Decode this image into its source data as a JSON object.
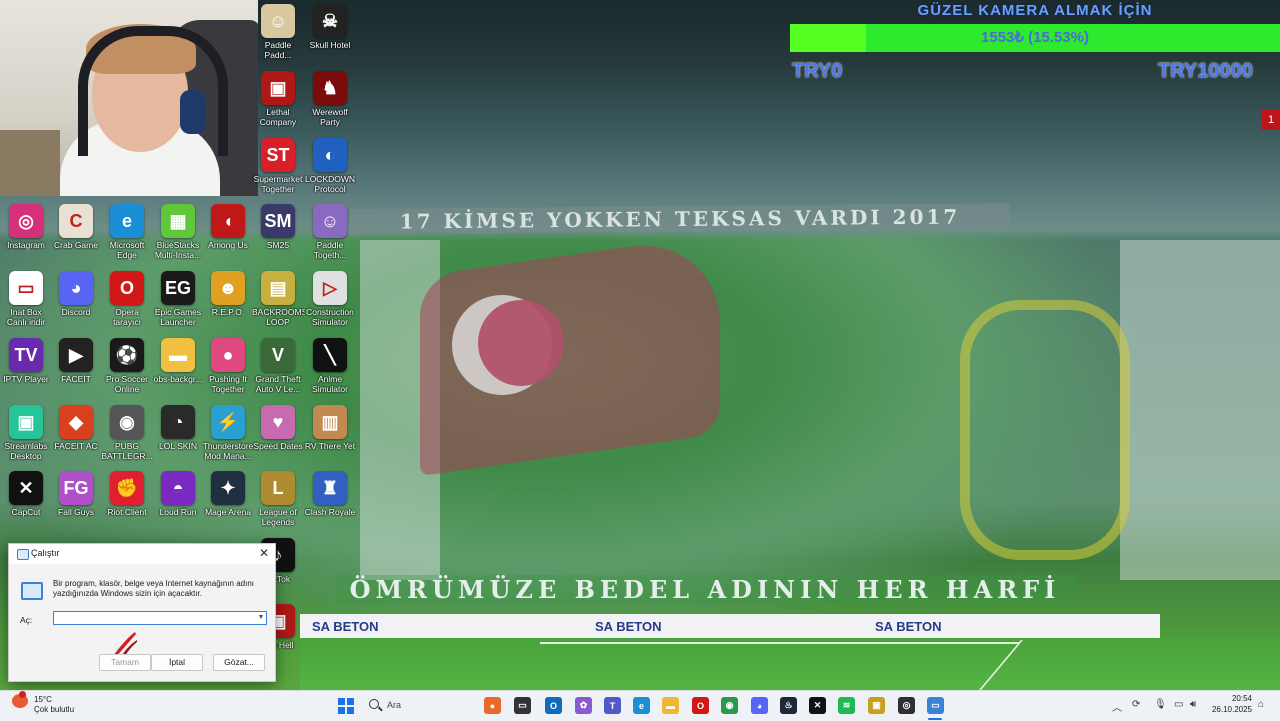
{
  "wallpaper": {
    "banner_top": "17 KİMSE YOKKEN TEKSAS VARDI 2017",
    "banner_bottom": "ÖMRÜMÜZE BEDEL ADININ HER HARFİ",
    "ads": [
      "SA BETON",
      "SA BETON",
      "SA BETON"
    ]
  },
  "goal": {
    "title": "GÜZEL KAMERA ALMAK İÇİN",
    "progress_text": "1553₺ (15.53%)",
    "progress_fraction": 0.1553,
    "min_label": "TRY0",
    "max_label": "TRY10000",
    "bar_color": "#2eea2e",
    "fill_color": "#55ff22"
  },
  "desktop_icons": [
    {
      "label": "Paddle Padd...",
      "icon": "paddle-icon",
      "color": "#d8c8a0",
      "glyph": "☺"
    },
    {
      "label": "Skull Hotel",
      "icon": "skull-hotel-icon",
      "color": "#222222",
      "glyph": "☠"
    },
    {
      "label": "Lethal Company",
      "icon": "lethal-company-icon",
      "color": "#b01818",
      "glyph": "▣"
    },
    {
      "label": "Werewolf Party",
      "icon": "werewolf-party-icon",
      "color": "#7a0c0c",
      "glyph": "♞"
    },
    {
      "label": "Supermarket Together",
      "icon": "supermarket-together-icon",
      "color": "#d8202a",
      "glyph": "ST"
    },
    {
      "label": "LOCKDOWN Protocol",
      "icon": "lockdown-protocol-icon",
      "color": "#2060c0",
      "glyph": "◐"
    },
    {
      "label": "Instagram",
      "icon": "instagram-icon",
      "color": "#d6307a",
      "glyph": "◎"
    },
    {
      "label": "Crab Game",
      "icon": "crab-game-icon",
      "color": "#e8e0d0",
      "glyph": "C"
    },
    {
      "label": "Microsoft Edge",
      "icon": "edge-icon",
      "color": "#1b8fd6",
      "glyph": "e"
    },
    {
      "label": "BlueStacks Multi-Insta...",
      "icon": "bluestacks-icon",
      "color": "#5fc83a",
      "glyph": "▦"
    },
    {
      "label": "Among Us",
      "icon": "among-us-icon",
      "color": "#c01818",
      "glyph": "◖"
    },
    {
      "label": "SM25",
      "icon": "sm25-icon",
      "color": "#3a3a6a",
      "glyph": "SM"
    },
    {
      "label": "Paddle Togeth...",
      "icon": "paddle-together-icon",
      "color": "#8a6ac0",
      "glyph": "☺"
    },
    {
      "label": "Inat Box Canlı indir Turbo",
      "icon": "inatbox-icon",
      "color": "#ffffff",
      "glyph": "▭"
    },
    {
      "label": "Discord",
      "icon": "discord-icon",
      "color": "#5865f2",
      "glyph": "◕"
    },
    {
      "label": "Opera tarayıcı",
      "icon": "opera-icon",
      "color": "#d01818",
      "glyph": "O"
    },
    {
      "label": "Epic Games Launcher",
      "icon": "epic-games-icon",
      "color": "#1a1a1a",
      "glyph": "EG"
    },
    {
      "label": "R.E.P.O.",
      "icon": "repo-icon",
      "color": "#e0a020",
      "glyph": "☻"
    },
    {
      "label": "BACKROOMS LOOP",
      "icon": "backrooms-icon",
      "color": "#c8b040",
      "glyph": "▤"
    },
    {
      "label": "Construction Simulator",
      "icon": "construction-simulator-icon",
      "color": "#e0e0e0",
      "glyph": "▷"
    },
    {
      "label": "IPTV Player",
      "icon": "iptv-icon",
      "color": "#6a2ab0",
      "glyph": "TV"
    },
    {
      "label": "FACEIT",
      "icon": "faceit-icon",
      "color": "#222222",
      "glyph": "▶"
    },
    {
      "label": "Pro Soccer Online",
      "icon": "pro-soccer-icon",
      "color": "#1a1a1a",
      "glyph": "⚽"
    },
    {
      "label": "obs-backgr...",
      "icon": "folder-icon",
      "color": "#f0c040",
      "glyph": "▬"
    },
    {
      "label": "Pushing It Together",
      "icon": "pushing-it-icon",
      "color": "#e04880",
      "glyph": "●"
    },
    {
      "label": "Grand Theft Auto V Le...",
      "icon": "gta-icon",
      "color": "#3a6a3a",
      "glyph": "V"
    },
    {
      "label": "Anime Simulator",
      "icon": "anime-simulator-icon",
      "color": "#111111",
      "glyph": "╲"
    },
    {
      "label": "Streamlabs Desktop",
      "icon": "streamlabs-icon",
      "color": "#27c49a",
      "glyph": "▣"
    },
    {
      "label": "FACEIT AC",
      "icon": "faceit-ac-icon",
      "color": "#d84020",
      "glyph": "◆"
    },
    {
      "label": "PUBG BATTLEGR...",
      "icon": "pubg-icon",
      "color": "#555555",
      "glyph": "◉"
    },
    {
      "label": "LOL SKIN",
      "icon": "lol-skin-icon",
      "color": "#2a2a2a",
      "glyph": "◔"
    },
    {
      "label": "Thunderstore Mod Mana...",
      "icon": "thunderstore-icon",
      "color": "#2aa0d0",
      "glyph": "⚡"
    },
    {
      "label": "Speed Dates",
      "icon": "speed-dates-icon",
      "color": "#c86ab0",
      "glyph": "♥"
    },
    {
      "label": "RV There Yet",
      "icon": "rv-there-yet-icon",
      "color": "#c08a50",
      "glyph": "▥"
    },
    {
      "label": "CapCut",
      "icon": "capcut-icon",
      "color": "#111111",
      "glyph": "✕"
    },
    {
      "label": "Fall Guys",
      "icon": "fall-guys-icon",
      "color": "#b050c8",
      "glyph": "FG"
    },
    {
      "label": "Riot Client",
      "icon": "riot-client-icon",
      "color": "#e02030",
      "glyph": "✊"
    },
    {
      "label": "Loud Run",
      "icon": "loud-run-icon",
      "color": "#7a2ac0",
      "glyph": "◓"
    },
    {
      "label": "Mage Arena",
      "icon": "mage-arena-icon",
      "color": "#203040",
      "glyph": "✦"
    },
    {
      "label": "League of Legends",
      "icon": "league-of-legends-icon",
      "color": "#b08a30",
      "glyph": "L"
    },
    {
      "label": "Clash Royale",
      "icon": "clash-royale-icon",
      "color": "#3060c0",
      "glyph": "♜"
    },
    {
      "label": "TikTok",
      "icon": "tiktok-icon",
      "color": "#111111",
      "glyph": "♪"
    },
    {
      "label": "...m Hell",
      "icon": "game-hell-icon",
      "color": "#b01818",
      "glyph": "▣"
    }
  ],
  "run_dialog": {
    "title": "Çalıştır",
    "description": "Bir program, klasör, belge veya Internet kaynağının adını yazdığınızda Windows sizin için açacaktır.",
    "open_label": "Aç:",
    "input_value": "",
    "ok_label": "Tamam",
    "cancel_label": "İptal",
    "browse_label": "Gözat..."
  },
  "taskbar": {
    "temperature": "15°C",
    "weather": "Çok bulutlu",
    "search_placeholder": "Ara",
    "time": "20:54",
    "date": "26.10.2025",
    "apps": [
      {
        "name": "widgets-icon",
        "color": "#e86a2a",
        "glyph": "●"
      },
      {
        "name": "task-view-icon",
        "color": "#333333",
        "glyph": "▭"
      },
      {
        "name": "outlook-icon",
        "color": "#0f6cbd",
        "glyph": "O"
      },
      {
        "name": "copilot-icon",
        "color": "#8a5ad0",
        "glyph": "✿"
      },
      {
        "name": "teams-icon",
        "color": "#5059c9",
        "glyph": "T"
      },
      {
        "name": "edge-taskbar-icon",
        "color": "#1b8fd6",
        "glyph": "e"
      },
      {
        "name": "file-explorer-icon",
        "color": "#f0b830",
        "glyph": "▬"
      },
      {
        "name": "opera-taskbar-icon",
        "color": "#d01818",
        "glyph": "O"
      },
      {
        "name": "chrome-icon",
        "color": "#2a9a4a",
        "glyph": "◉"
      },
      {
        "name": "discord-taskbar-icon",
        "color": "#5865f2",
        "glyph": "◕"
      },
      {
        "name": "steam-icon",
        "color": "#1b2838",
        "glyph": "♨"
      },
      {
        "name": "capcut-taskbar-icon",
        "color": "#111111",
        "glyph": "✕"
      },
      {
        "name": "spotify-icon",
        "color": "#1db954",
        "glyph": "≋"
      },
      {
        "name": "lock-app-icon",
        "color": "#c8a020",
        "glyph": "▣"
      },
      {
        "name": "obs-icon",
        "color": "#303030",
        "glyph": "◎"
      },
      {
        "name": "run-taskbar-icon",
        "color": "#3b82d6",
        "glyph": "▭"
      }
    ]
  }
}
